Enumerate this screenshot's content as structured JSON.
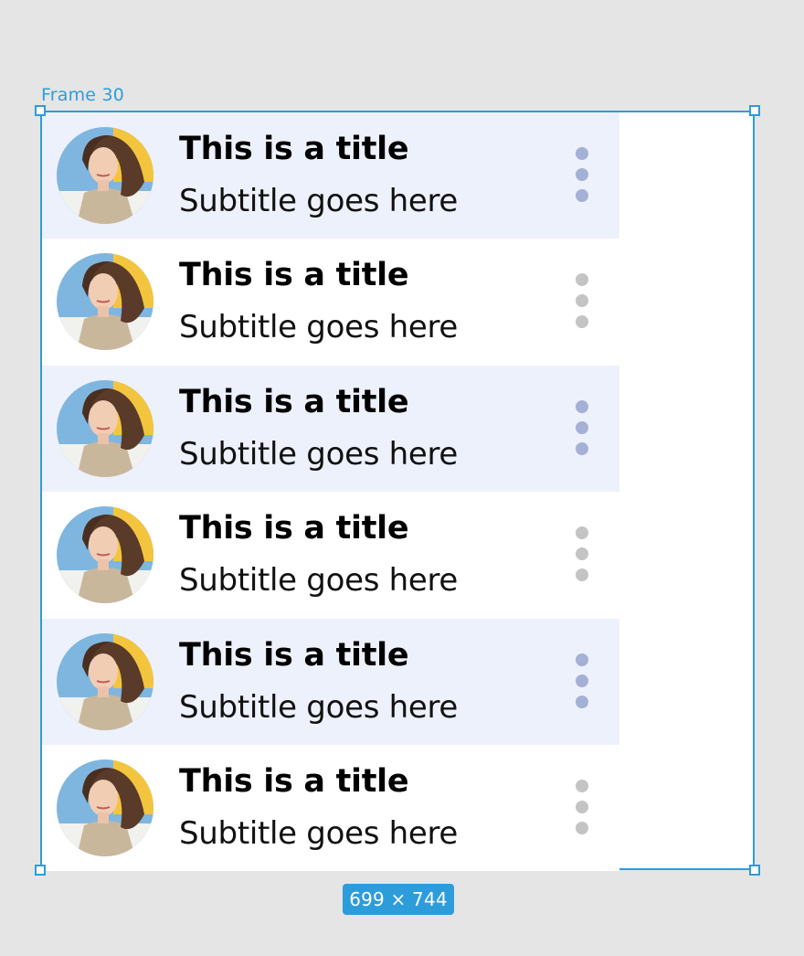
{
  "frame": {
    "label": "Frame 30",
    "size_badge": "699 × 744",
    "accent_color": "#2d9cdb"
  },
  "list": {
    "alt_row_color": "#edf1fb",
    "items": [
      {
        "title": "This is a title",
        "subtitle": "Subtitle goes here",
        "highlighted": true,
        "avatar_icon": "avatar-photo-icon",
        "menu_icon": "more-vertical-icon"
      },
      {
        "title": "This is a title",
        "subtitle": "Subtitle goes here",
        "highlighted": false,
        "avatar_icon": "avatar-photo-icon",
        "menu_icon": "more-vertical-icon"
      },
      {
        "title": "This is a title",
        "subtitle": "Subtitle goes here",
        "highlighted": true,
        "avatar_icon": "avatar-photo-icon",
        "menu_icon": "more-vertical-icon"
      },
      {
        "title": "This is a title",
        "subtitle": "Subtitle goes here",
        "highlighted": false,
        "avatar_icon": "avatar-photo-icon",
        "menu_icon": "more-vertical-icon"
      },
      {
        "title": "This is a title",
        "subtitle": "Subtitle goes here",
        "highlighted": true,
        "avatar_icon": "avatar-photo-icon",
        "menu_icon": "more-vertical-icon"
      },
      {
        "title": "This is a title",
        "subtitle": "Subtitle goes here",
        "highlighted": false,
        "avatar_icon": "avatar-photo-icon",
        "menu_icon": "more-vertical-icon"
      }
    ]
  }
}
